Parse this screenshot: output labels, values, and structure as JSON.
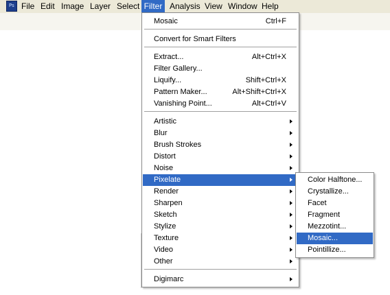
{
  "menubar": {
    "items": [
      "File",
      "Edit",
      "Image",
      "Layer",
      "Select",
      "Filter",
      "Analysis",
      "View",
      "Window",
      "Help"
    ],
    "active": "Filter"
  },
  "filter_menu": {
    "last_filter": {
      "label": "Mosaic",
      "shortcut": "Ctrl+F"
    },
    "convert_smart": "Convert for Smart Filters",
    "tools": [
      {
        "label": "Extract...",
        "shortcut": "Alt+Ctrl+X"
      },
      {
        "label": "Filter Gallery...",
        "shortcut": ""
      },
      {
        "label": "Liquify...",
        "shortcut": "Shift+Ctrl+X"
      },
      {
        "label": "Pattern Maker...",
        "shortcut": "Alt+Shift+Ctrl+X"
      },
      {
        "label": "Vanishing Point...",
        "shortcut": "Alt+Ctrl+V"
      }
    ],
    "categories": [
      "Artistic",
      "Blur",
      "Brush Strokes",
      "Distort",
      "Noise",
      "Pixelate",
      "Render",
      "Sharpen",
      "Sketch",
      "Stylize",
      "Texture",
      "Video",
      "Other"
    ],
    "highlighted_category": "Pixelate",
    "plugins": [
      "Digimarc"
    ]
  },
  "pixelate_submenu": {
    "items": [
      "Color Halftone...",
      "Crystallize...",
      "Facet",
      "Fragment",
      "Mezzotint...",
      "Mosaic...",
      "Pointillize..."
    ],
    "highlighted": "Mosaic..."
  },
  "colors": {
    "highlight": "#316ac5",
    "menubar_bg": "#ece9d8"
  }
}
